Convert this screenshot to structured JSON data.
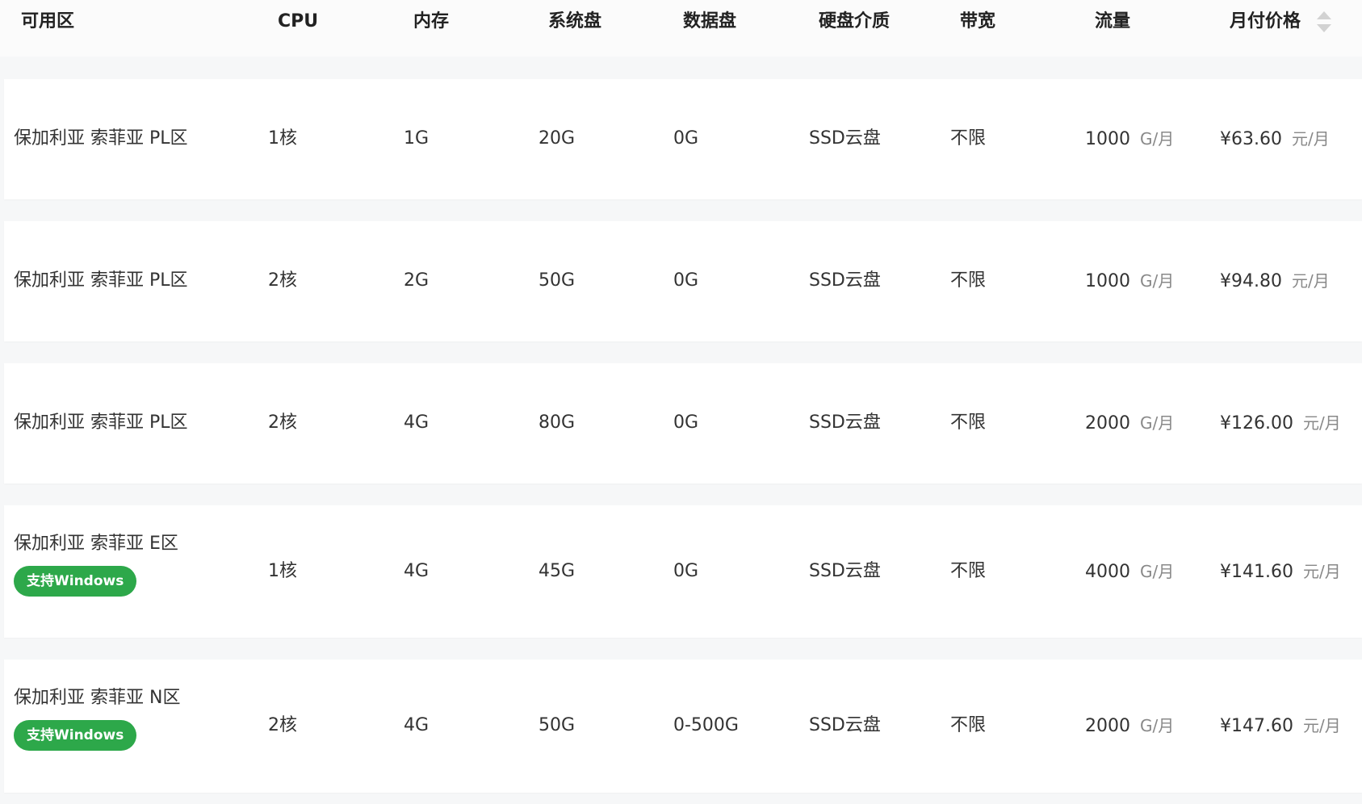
{
  "header": {
    "zone": "可用区",
    "cpu": "CPU",
    "memory": "内存",
    "system_disk": "系统盘",
    "data_disk": "数据盘",
    "disk_media": "硬盘介质",
    "bandwidth": "带宽",
    "traffic": "流量",
    "monthly_price": "月付价格"
  },
  "rows": [
    {
      "zone": "保加利亚 索菲亚 PL区",
      "badge": "",
      "cpu": "1核",
      "memory": "1G",
      "system_disk": "20G",
      "data_disk": "0G",
      "disk_media": "SSD云盘",
      "bandwidth": "不限",
      "traffic": "1000",
      "traffic_unit": "G/月",
      "price": "¥63.60",
      "price_unit": "元/月"
    },
    {
      "zone": "保加利亚 索菲亚 PL区",
      "badge": "",
      "cpu": "2核",
      "memory": "2G",
      "system_disk": "50G",
      "data_disk": "0G",
      "disk_media": "SSD云盘",
      "bandwidth": "不限",
      "traffic": "1000",
      "traffic_unit": "G/月",
      "price": "¥94.80",
      "price_unit": "元/月"
    },
    {
      "zone": "保加利亚 索菲亚 PL区",
      "badge": "",
      "cpu": "2核",
      "memory": "4G",
      "system_disk": "80G",
      "data_disk": "0G",
      "disk_media": "SSD云盘",
      "bandwidth": "不限",
      "traffic": "2000",
      "traffic_unit": "G/月",
      "price": "¥126.00",
      "price_unit": "元/月"
    },
    {
      "zone": "保加利亚 索菲亚 E区",
      "badge": "支持Windows",
      "cpu": "1核",
      "memory": "4G",
      "system_disk": "45G",
      "data_disk": "0G",
      "disk_media": "SSD云盘",
      "bandwidth": "不限",
      "traffic": "4000",
      "traffic_unit": "G/月",
      "price": "¥141.60",
      "price_unit": "元/月"
    },
    {
      "zone": "保加利亚 索菲亚 N区",
      "badge": "支持Windows",
      "cpu": "2核",
      "memory": "4G",
      "system_disk": "50G",
      "data_disk": "0-500G",
      "disk_media": "SSD云盘",
      "bandwidth": "不限",
      "traffic": "2000",
      "traffic_unit": "G/月",
      "price": "¥147.60",
      "price_unit": "元/月"
    }
  ],
  "colors": {
    "badge_green": "#2da84a",
    "unit_gray": "#888888",
    "row_bg": "#ffffff",
    "page_bg": "#f6f7f8"
  },
  "icons": {
    "sort": "sort-icon"
  }
}
